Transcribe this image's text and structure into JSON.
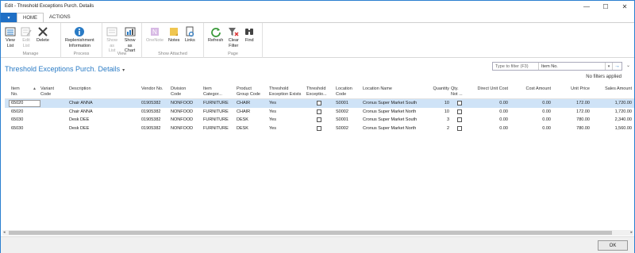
{
  "window": {
    "title": "Edit - Threshold Exceptions Purch. Details",
    "min": "—",
    "max": "☐",
    "close": "✕"
  },
  "tabs": {
    "app_menu": "▾",
    "home": "HOME",
    "actions": "ACTIONS"
  },
  "ribbon": {
    "groups": [
      {
        "label": "Manage",
        "buttons": [
          {
            "label": "View\nList",
            "icon": "view-list-icon",
            "disabled": false
          },
          {
            "label": "Edit\nList",
            "icon": "edit-list-icon",
            "disabled": true
          },
          {
            "label": "Delete",
            "icon": "delete-icon",
            "disabled": false
          }
        ]
      },
      {
        "label": "Process",
        "buttons": [
          {
            "label": "Replenishment\nInformation",
            "icon": "info-icon",
            "disabled": false
          }
        ]
      },
      {
        "label": "View",
        "buttons": [
          {
            "label": "Show\nas List",
            "icon": "show-as-list-icon",
            "disabled": true
          },
          {
            "label": "Show as\nChart",
            "icon": "show-as-chart-icon",
            "disabled": false
          }
        ]
      },
      {
        "label": "Show Attached",
        "buttons": [
          {
            "label": "OneNote",
            "icon": "onenote-icon",
            "disabled": true
          },
          {
            "label": "Notes",
            "icon": "notes-icon",
            "disabled": false
          },
          {
            "label": "Links",
            "icon": "links-icon",
            "disabled": false
          }
        ]
      },
      {
        "label": "Page",
        "buttons": [
          {
            "label": "Refresh",
            "icon": "refresh-icon",
            "disabled": false
          },
          {
            "label": "Clear\nFilter",
            "icon": "clear-filter-icon",
            "disabled": false
          },
          {
            "label": "Find",
            "icon": "find-icon",
            "disabled": false
          }
        ]
      }
    ]
  },
  "page": {
    "title": "Threshold Exceptions Purch. Details",
    "title_caret": "▾",
    "filter_placeholder": "Type to filter (F3)",
    "filter_field": "Item No.",
    "no_filters": "No filters applied"
  },
  "columns": [
    "Item\nNo.",
    "Variant\nCode",
    "Description",
    "Vendor No.",
    "Division\nCode",
    "Item\nCategor...",
    "Product\nGroup Code",
    "Threshold\nException Exists",
    "Threshold\nExceptio...",
    "Location\nCode",
    "Location Name",
    "Quantity",
    "Qty.\nNot ...",
    "Direct Unit Cost",
    "Cost Amount",
    "Unit Price",
    "Sales Amount"
  ],
  "rows": [
    {
      "item_no": "65020",
      "variant": "",
      "description": "Chair ANNA",
      "vendor": "01905382",
      "division": "NONFOOD",
      "category": "FURNITURE",
      "group": "CHAIR",
      "exists": "Yes",
      "location": "S0001",
      "location_name": "Cronus Super Market South",
      "quantity": "10",
      "direct_cost": "0.00",
      "cost_amount": "0.00",
      "unit_price": "172.00",
      "sales_amount": "1,720.00"
    },
    {
      "item_no": "65020",
      "variant": "",
      "description": "Chair ANNA",
      "vendor": "01905382",
      "division": "NONFOOD",
      "category": "FURNITURE",
      "group": "CHAIR",
      "exists": "Yes",
      "location": "S0002",
      "location_name": "Cronus Super Market North",
      "quantity": "10",
      "direct_cost": "0.00",
      "cost_amount": "0.00",
      "unit_price": "172.00",
      "sales_amount": "1,720.00"
    },
    {
      "item_no": "65030",
      "variant": "",
      "description": "Desk DEE",
      "vendor": "01905382",
      "division": "NONFOOD",
      "category": "FURNITURE",
      "group": "DESK",
      "exists": "Yes",
      "location": "S0001",
      "location_name": "Cronus Super Market South",
      "quantity": "3",
      "direct_cost": "0.00",
      "cost_amount": "0.00",
      "unit_price": "780.00",
      "sales_amount": "2,340.00"
    },
    {
      "item_no": "65030",
      "variant": "",
      "description": "Desk DEE",
      "vendor": "01905382",
      "division": "NONFOOD",
      "category": "FURNITURE",
      "group": "DESK",
      "exists": "Yes",
      "location": "S0002",
      "location_name": "Cronus Super Market North",
      "quantity": "2",
      "direct_cost": "0.00",
      "cost_amount": "0.00",
      "unit_price": "780.00",
      "sales_amount": "1,560.00"
    }
  ],
  "footer": {
    "ok": "OK"
  }
}
